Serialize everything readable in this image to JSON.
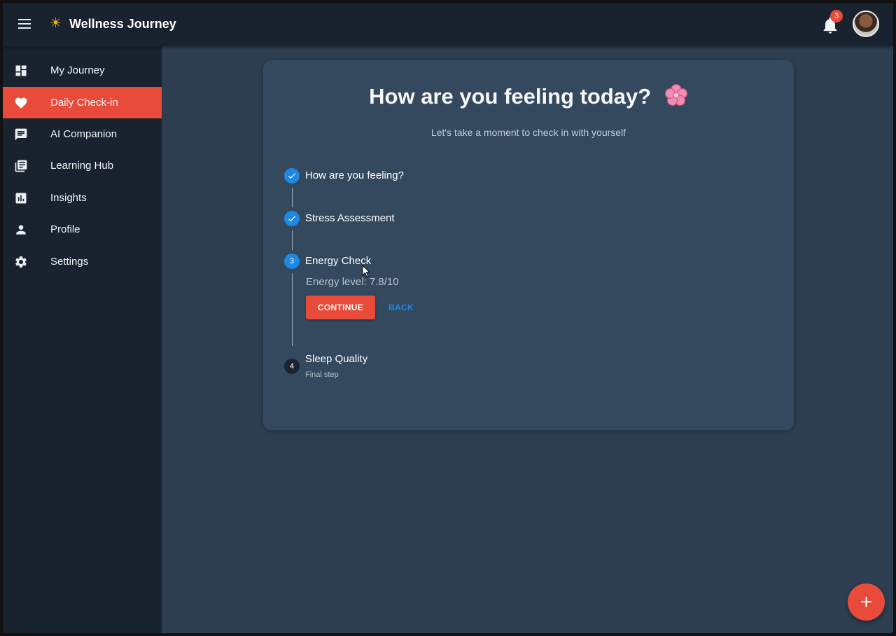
{
  "app": {
    "title": "Wellness Journey",
    "logo_icon": "sun-icon"
  },
  "header": {
    "notification_count": "3"
  },
  "sidebar": {
    "items": [
      {
        "label": "My Journey",
        "icon": "dashboard-icon",
        "active": false
      },
      {
        "label": "Daily Check-in",
        "icon": "heart-icon",
        "active": true
      },
      {
        "label": "AI Companion",
        "icon": "chat-icon",
        "active": false
      },
      {
        "label": "Learning Hub",
        "icon": "library-icon",
        "active": false
      },
      {
        "label": "Insights",
        "icon": "chart-icon",
        "active": false
      },
      {
        "label": "Profile",
        "icon": "person-icon",
        "active": false
      },
      {
        "label": "Settings",
        "icon": "gear-icon",
        "active": false
      }
    ]
  },
  "checkin": {
    "title": "How are you feeling today?",
    "subtitle": "Let's take a moment to check in with yourself",
    "steps": [
      {
        "label": "How are you feeling?",
        "status": "completed"
      },
      {
        "label": "Stress Assessment",
        "status": "completed"
      },
      {
        "number": "3",
        "label": "Energy Check",
        "status": "active",
        "content": "Energy level: 7.8/10"
      },
      {
        "number": "4",
        "label": "Sleep Quality",
        "status": "pending",
        "caption": "Final step"
      }
    ],
    "continue_label": "CONTINUE",
    "back_label": "BACK"
  },
  "fab": {
    "label": "+"
  },
  "colors": {
    "accent": "#e84b3a",
    "primary": "#1e88e5",
    "background": "#2c3e50",
    "card": "#34495e",
    "sidebar": "#19232f"
  }
}
